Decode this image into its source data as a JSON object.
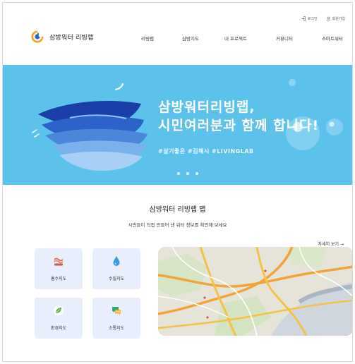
{
  "util": {
    "login": "로그인",
    "signup": "회원가입"
  },
  "logo": {
    "text": "삼방워터 리빙랩"
  },
  "nav": [
    "리빙랩",
    "삼방지도",
    "내 프로젝트",
    "커뮤니티",
    "스마트워터"
  ],
  "banner": {
    "title_line1": "삼방워터리빙랩,",
    "title_line2": "시민여러분과 함께 합니다!",
    "tags": "#살기좋은  #김해시  #LIVINGLAB",
    "slides": 3,
    "active_slide": 1
  },
  "section": {
    "title": "삼방워터 리빙랩 맵",
    "subtitle": "시민들이 직접 만들어 낸 워터 정보를 확인해 보세요",
    "more": "자세히 보기 →"
  },
  "cards": [
    {
      "label": "홍수지도",
      "icon": "flood-icon"
    },
    {
      "label": "수질지도",
      "icon": "water-drop-icon"
    },
    {
      "label": "환경지도",
      "icon": "leaf-icon"
    },
    {
      "label": "소통지도",
      "icon": "chat-icon"
    }
  ],
  "colors": {
    "banner": "#5cc2ec",
    "card_bg": "#e8eefc",
    "accent_orange": "#f2a32b",
    "accent_blue": "#1b6fc4"
  }
}
